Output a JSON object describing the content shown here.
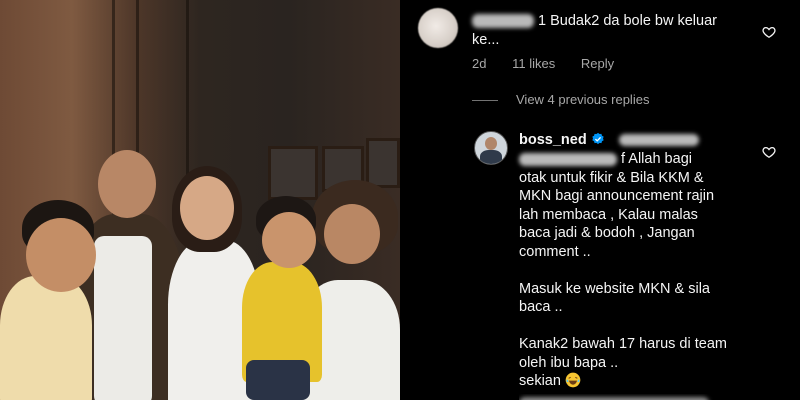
{
  "comment1": {
    "text_line1": "1 Budak2 da bole bw keluar",
    "text_line2": "ke...",
    "time": "2d",
    "likes": "11 likes",
    "reply_label": "Reply"
  },
  "view_replies_label": "View 4 previous replies",
  "comment2": {
    "username": "boss_ned",
    "lines": [
      "f Allah bagi",
      "otak untuk fikir & Bila KKM &",
      "MKN bagi announcement rajin",
      "lah membaca , Kalau malas",
      "baca jadi & bodoh , Jangan",
      "comment ..",
      "",
      "Masuk ke website MKN & sila",
      "baca ..",
      "",
      "Kanak2 bawah 17 harus di team",
      "oleh ibu bapa ..",
      "sekian"
    ]
  },
  "colors": {
    "background": "#000000",
    "primary_text": "#f5f5f5",
    "secondary_text": "#a8a8a8",
    "verified_blue": "#0095f6"
  },
  "icons": [
    "heart-icon",
    "verified-badge-icon",
    "laughing-emoji-icon"
  ]
}
